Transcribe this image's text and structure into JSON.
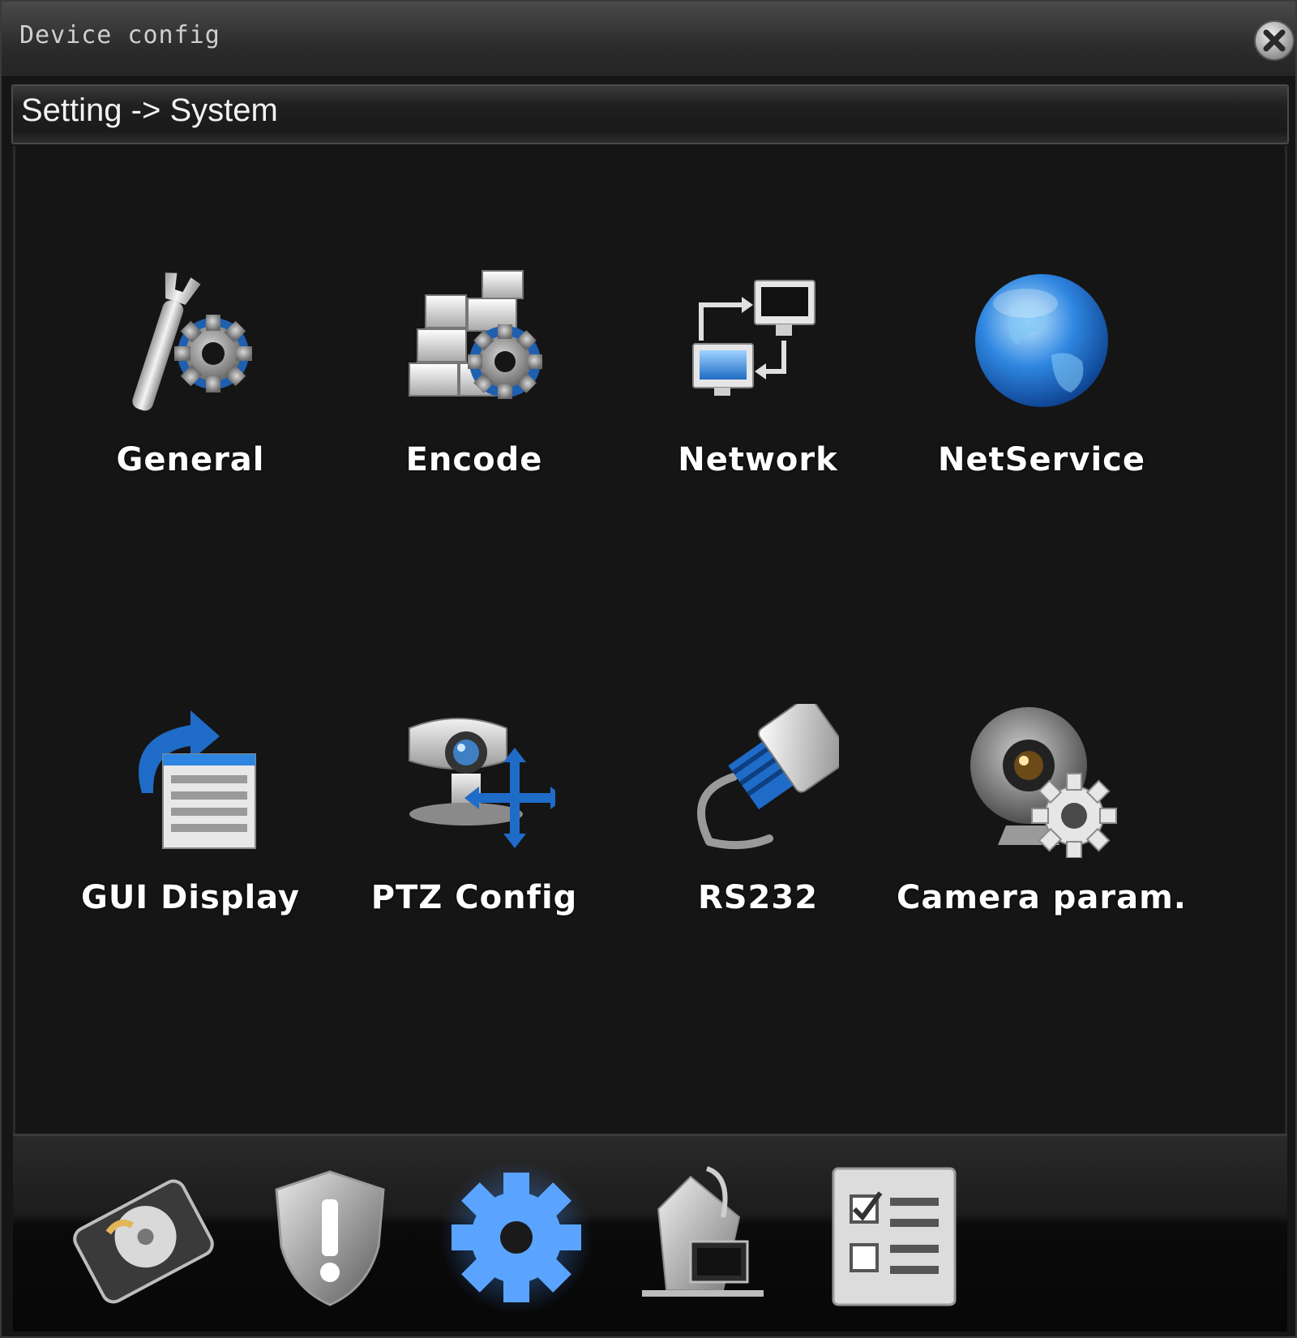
{
  "window": {
    "title": "Device config"
  },
  "breadcrumb": "Setting -> System",
  "tiles": [
    {
      "label": "General",
      "icon": "wrench-gear-icon"
    },
    {
      "label": "Encode",
      "icon": "bricks-gear-icon"
    },
    {
      "label": "Network",
      "icon": "network-computers-icon"
    },
    {
      "label": "NetService",
      "icon": "globe-icon"
    },
    {
      "label": "GUI Display",
      "icon": "display-list-icon"
    },
    {
      "label": "PTZ Config",
      "icon": "ptz-camera-icon"
    },
    {
      "label": "RS232",
      "icon": "serial-connector-icon"
    },
    {
      "label": "Camera param.",
      "icon": "webcam-gear-icon"
    }
  ],
  "dock": [
    {
      "icon": "hard-disk-icon",
      "active": false
    },
    {
      "icon": "alarm-shield-icon",
      "active": false
    },
    {
      "icon": "system-gear-icon",
      "active": true
    },
    {
      "icon": "management-tools-icon",
      "active": false
    },
    {
      "icon": "checklist-info-icon",
      "active": false
    }
  ],
  "colors": {
    "accent_blue": "#2f86e0",
    "background": "#151515",
    "text": "#ffffff"
  }
}
